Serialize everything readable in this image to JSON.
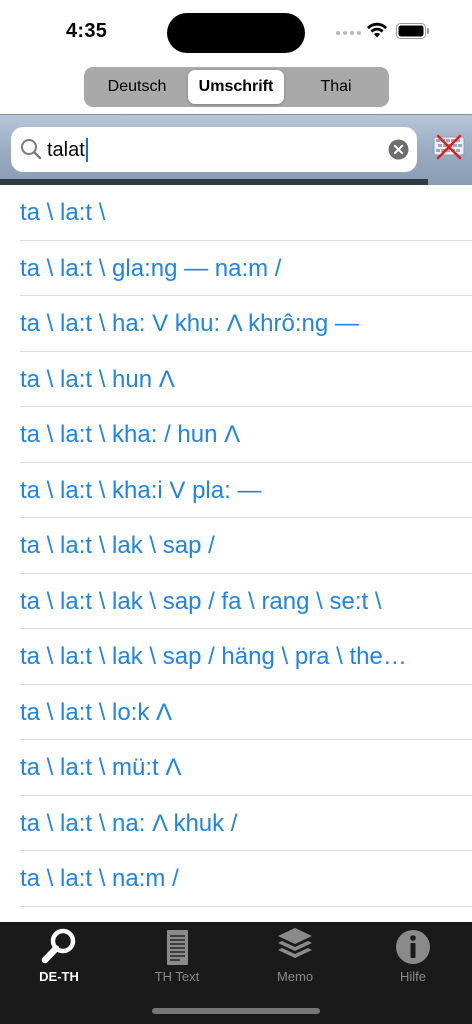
{
  "status": {
    "time": "4:35"
  },
  "segments": [
    {
      "label": "Deutsch",
      "selected": false
    },
    {
      "label": "Umschrift",
      "selected": true
    },
    {
      "label": "Thai",
      "selected": false
    }
  ],
  "search": {
    "value": "talat"
  },
  "results": [
    "ta \\ la:t \\",
    "ta \\ la:t \\ gla:ng — na:m /",
    "ta \\ la:t \\ ha: V khu: Λ khrô:ng —",
    "ta \\ la:t \\ hun Λ",
    "ta \\ la:t \\ kha: / hun Λ",
    "ta \\ la:t \\ kha:i V pla: —",
    "ta \\ la:t \\ lak \\ sap /",
    "ta \\ la:t \\ lak \\ sap / fa \\ rang \\ se:t \\",
    "ta \\ la:t \\ lak \\ sap / häng \\ pra \\ the…",
    "ta \\ la:t \\ lo:k Λ",
    "ta \\ la:t \\ mü:t Λ",
    "ta \\ la:t \\ na: Λ khuk /",
    "ta \\ la:t \\ na:m /"
  ],
  "tabs": [
    {
      "label": "DE-TH",
      "icon": "magnifier-icon",
      "active": true
    },
    {
      "label": "TH Text",
      "icon": "document-icon",
      "active": false
    },
    {
      "label": "Memo",
      "icon": "layers-icon",
      "active": false
    },
    {
      "label": "Hilfe",
      "icon": "info-icon",
      "active": false
    }
  ],
  "colors": {
    "link": "#1e84ea",
    "tabbar": "#1a1a1a",
    "search_bg": "#98aac0"
  }
}
